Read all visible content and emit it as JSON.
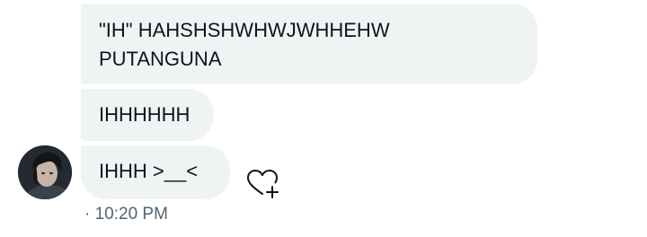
{
  "conversation": {
    "messages": [
      {
        "text": "\"IH\" HAHSHSHWHWJWHHEHW\nPUTANGUNA"
      },
      {
        "text": "IHHHHHH"
      },
      {
        "text": "IHHH >__<"
      }
    ],
    "sender_avatar_icon": "user-avatar",
    "reaction_icon": "heart-plus-icon",
    "timestamp": "· 10:20 PM"
  },
  "colors": {
    "bubble_background": "#eff3f4",
    "text": "#0f1419",
    "muted_text": "#536471"
  }
}
